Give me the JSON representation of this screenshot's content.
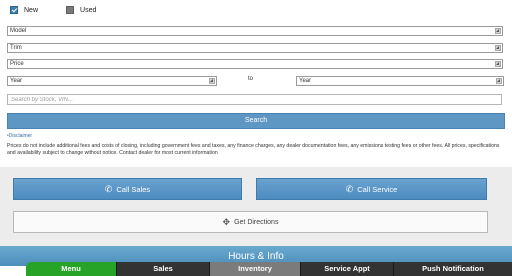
{
  "condition": {
    "new_label": "New",
    "used_label": "Used"
  },
  "filters": {
    "model": "Model",
    "trim": "Trim",
    "price": "Price",
    "year_from": "Year",
    "year_to": "Year",
    "to_label": "to"
  },
  "search": {
    "placeholder": "Search by Stock, VIN...",
    "button_label": "Search"
  },
  "disclaimer": {
    "link": "•Disclaimer",
    "text": "Prices do not include additional fees and costs of closing, including government fees and taxes, any finance charges, any dealer documentation fees, any emissions testing fees or other fees. All prices, specifications and availability subject to change without notice. Contact dealer for most current information"
  },
  "contact": {
    "call_sales": "Call Sales",
    "call_service": "Call Service",
    "get_directions": "Get Directions"
  },
  "hours_label": "Hours & Info",
  "nav": {
    "menu": "Menu",
    "sales": "Sales",
    "inventory": "Inventory",
    "service_appt": "Service Appt",
    "push_notification": "Push Notification"
  },
  "colors": {
    "accent": "#5f97c4",
    "nav_active": "#27a327",
    "nav_dark": "#333333"
  }
}
